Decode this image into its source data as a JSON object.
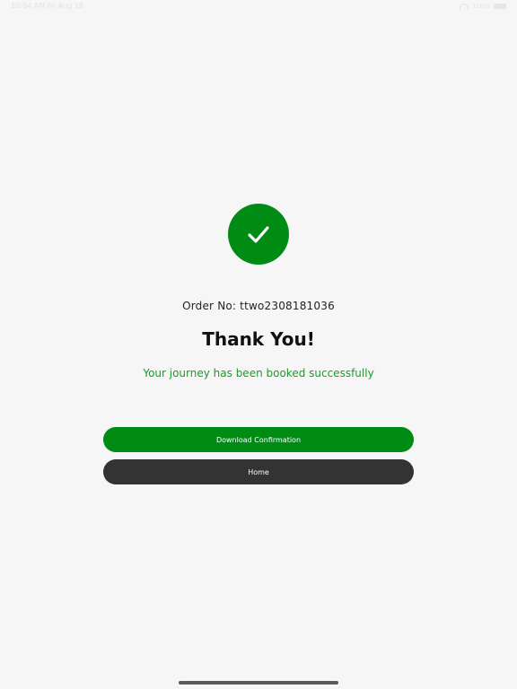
{
  "status_bar": {
    "time": "10:04 AM Fri Aug 18",
    "battery_pct": "100%"
  },
  "icons": {
    "success": "checkmark-icon"
  },
  "order": {
    "label": "Order No: ttwo2308181036"
  },
  "heading": "Thank You!",
  "message": "Your journey has been booked successfully",
  "buttons": {
    "download_label": "Download Confirmation",
    "home_label": "Home"
  },
  "colors": {
    "accent_green": "#008c14",
    "message_green": "#1b9a2a",
    "dark_button": "#333333",
    "background": "#f6f6f6"
  }
}
